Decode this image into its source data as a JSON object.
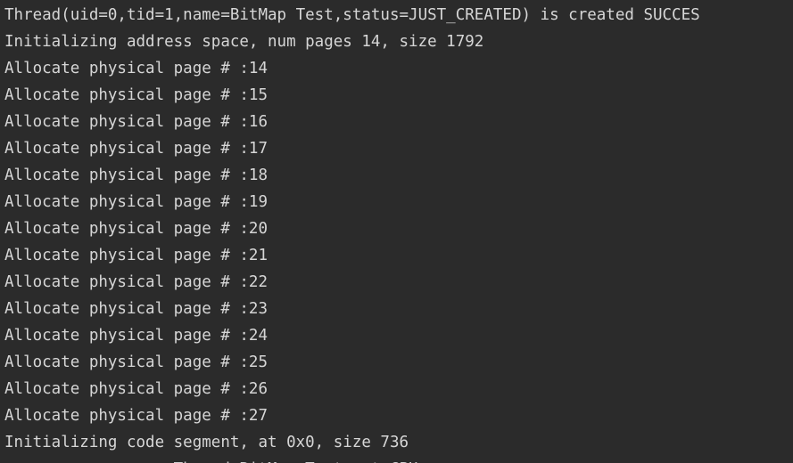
{
  "console": {
    "lines": [
      "Thread(uid=0,tid=1,name=BitMap Test,status=JUST_CREATED) is created SUCCES",
      "Initializing address space, num pages 14, size 1792",
      "Allocate physical page # :14",
      "Allocate physical page # :15",
      "Allocate physical page # :16",
      "Allocate physical page # :17",
      "Allocate physical page # :18",
      "Allocate physical page # :19",
      "Allocate physical page # :20",
      "Allocate physical page # :21",
      "Allocate physical page # :22",
      "Allocate physical page # :23",
      "Allocate physical page # :24",
      "Allocate physical page # :25",
      "Allocate physical page # :26",
      "Allocate physical page # :27",
      "Initializing code segment, at 0x0, size 736",
      "                  Thread BitMap Test put CPU"
    ]
  },
  "colors": {
    "background": "#2b2b2b",
    "text": "#d6d6d6"
  }
}
